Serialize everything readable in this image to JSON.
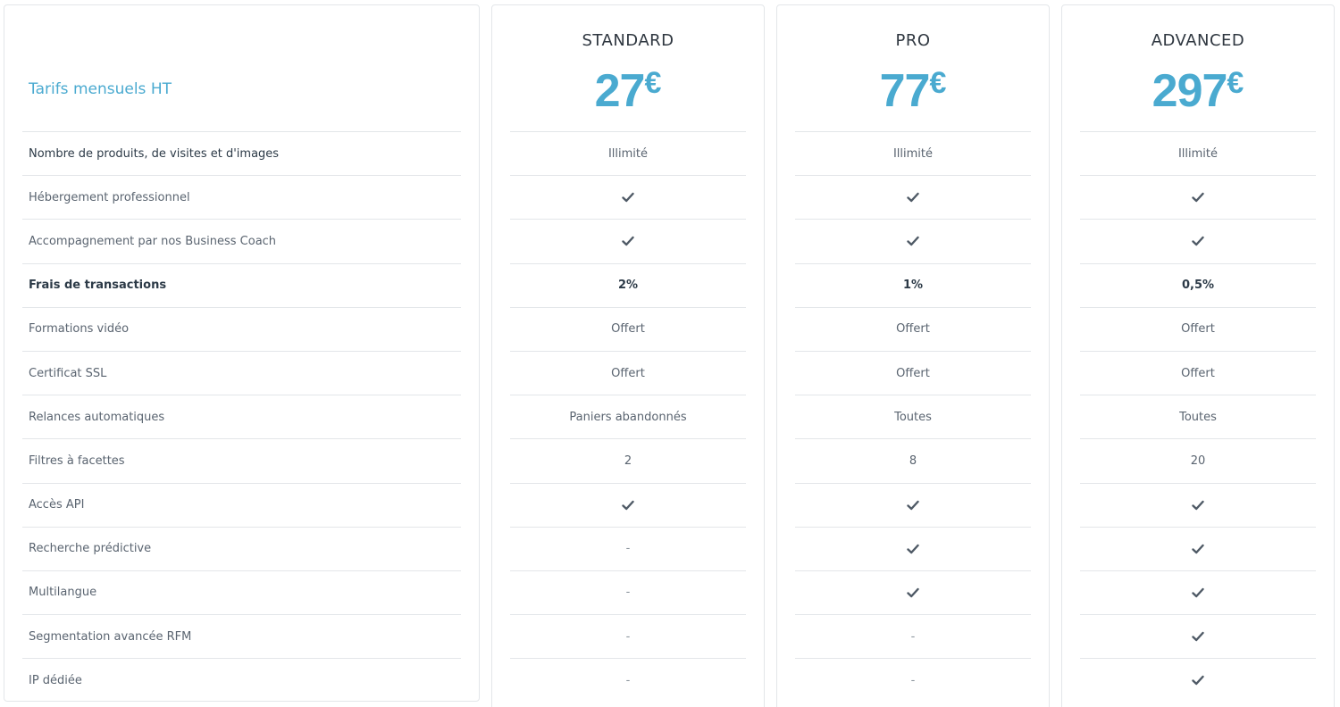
{
  "features": {
    "title": "Tarifs mensuels HT",
    "rows": [
      "Nombre de produits, de visites et d'images",
      "Hébergement professionnel",
      "Accompagnement par nos Business Coach",
      "Frais de transactions",
      "Formations vidéo",
      "Certificat SSL",
      "Relances automatiques",
      "Filtres à facettes",
      "Accès API",
      "Recherche prédictive",
      "Multilangue",
      "Segmentation avancée RFM",
      "IP dédiée"
    ]
  },
  "plans": [
    {
      "name": "STANDARD",
      "price": "27",
      "currency": "€",
      "values": [
        "Illimité",
        "check",
        "check",
        "2%",
        "Offert",
        "Offert",
        "Paniers abandonnés",
        "2",
        "check",
        "-",
        "-",
        "-",
        "-"
      ]
    },
    {
      "name": "PRO",
      "price": "77",
      "currency": "€",
      "values": [
        "Illimité",
        "check",
        "check",
        "1%",
        "Offert",
        "Offert",
        "Toutes",
        "8",
        "check",
        "check",
        "check",
        "-",
        "-"
      ]
    },
    {
      "name": "ADVANCED",
      "price": "297",
      "currency": "€",
      "values": [
        "Illimité",
        "check",
        "check",
        "0,5%",
        "Offert",
        "Offert",
        "Toutes",
        "20",
        "check",
        "check",
        "check",
        "check",
        "check"
      ]
    }
  ],
  "colors": {
    "accent": "#4aaad0",
    "check": "#4f5a66",
    "border": "#e3e6e9"
  }
}
